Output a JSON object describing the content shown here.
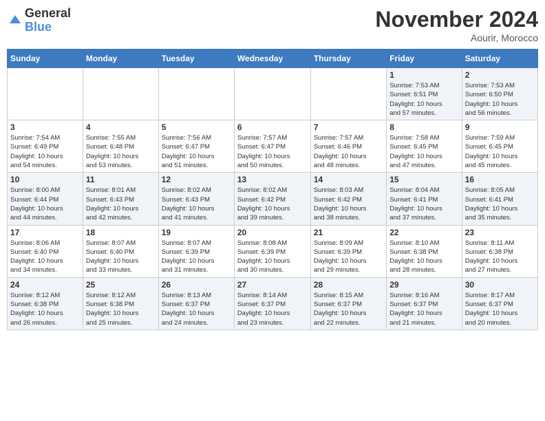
{
  "header": {
    "logo_general": "General",
    "logo_blue": "Blue",
    "month": "November 2024",
    "location": "Aourir, Morocco"
  },
  "weekdays": [
    "Sunday",
    "Monday",
    "Tuesday",
    "Wednesday",
    "Thursday",
    "Friday",
    "Saturday"
  ],
  "weeks": [
    [
      {
        "day": "",
        "detail": ""
      },
      {
        "day": "",
        "detail": ""
      },
      {
        "day": "",
        "detail": ""
      },
      {
        "day": "",
        "detail": ""
      },
      {
        "day": "",
        "detail": ""
      },
      {
        "day": "1",
        "detail": "Sunrise: 7:53 AM\nSunset: 6:51 PM\nDaylight: 10 hours\nand 57 minutes."
      },
      {
        "day": "2",
        "detail": "Sunrise: 7:53 AM\nSunset: 6:50 PM\nDaylight: 10 hours\nand 56 minutes."
      }
    ],
    [
      {
        "day": "3",
        "detail": "Sunrise: 7:54 AM\nSunset: 6:49 PM\nDaylight: 10 hours\nand 54 minutes."
      },
      {
        "day": "4",
        "detail": "Sunrise: 7:55 AM\nSunset: 6:48 PM\nDaylight: 10 hours\nand 53 minutes."
      },
      {
        "day": "5",
        "detail": "Sunrise: 7:56 AM\nSunset: 6:47 PM\nDaylight: 10 hours\nand 51 minutes."
      },
      {
        "day": "6",
        "detail": "Sunrise: 7:57 AM\nSunset: 6:47 PM\nDaylight: 10 hours\nand 50 minutes."
      },
      {
        "day": "7",
        "detail": "Sunrise: 7:57 AM\nSunset: 6:46 PM\nDaylight: 10 hours\nand 48 minutes."
      },
      {
        "day": "8",
        "detail": "Sunrise: 7:58 AM\nSunset: 6:45 PM\nDaylight: 10 hours\nand 47 minutes."
      },
      {
        "day": "9",
        "detail": "Sunrise: 7:59 AM\nSunset: 6:45 PM\nDaylight: 10 hours\nand 45 minutes."
      }
    ],
    [
      {
        "day": "10",
        "detail": "Sunrise: 8:00 AM\nSunset: 6:44 PM\nDaylight: 10 hours\nand 44 minutes."
      },
      {
        "day": "11",
        "detail": "Sunrise: 8:01 AM\nSunset: 6:43 PM\nDaylight: 10 hours\nand 42 minutes."
      },
      {
        "day": "12",
        "detail": "Sunrise: 8:02 AM\nSunset: 6:43 PM\nDaylight: 10 hours\nand 41 minutes."
      },
      {
        "day": "13",
        "detail": "Sunrise: 8:02 AM\nSunset: 6:42 PM\nDaylight: 10 hours\nand 39 minutes."
      },
      {
        "day": "14",
        "detail": "Sunrise: 8:03 AM\nSunset: 6:42 PM\nDaylight: 10 hours\nand 38 minutes."
      },
      {
        "day": "15",
        "detail": "Sunrise: 8:04 AM\nSunset: 6:41 PM\nDaylight: 10 hours\nand 37 minutes."
      },
      {
        "day": "16",
        "detail": "Sunrise: 8:05 AM\nSunset: 6:41 PM\nDaylight: 10 hours\nand 35 minutes."
      }
    ],
    [
      {
        "day": "17",
        "detail": "Sunrise: 8:06 AM\nSunset: 6:40 PM\nDaylight: 10 hours\nand 34 minutes."
      },
      {
        "day": "18",
        "detail": "Sunrise: 8:07 AM\nSunset: 6:40 PM\nDaylight: 10 hours\nand 33 minutes."
      },
      {
        "day": "19",
        "detail": "Sunrise: 8:07 AM\nSunset: 6:39 PM\nDaylight: 10 hours\nand 31 minutes."
      },
      {
        "day": "20",
        "detail": "Sunrise: 8:08 AM\nSunset: 6:39 PM\nDaylight: 10 hours\nand 30 minutes."
      },
      {
        "day": "21",
        "detail": "Sunrise: 8:09 AM\nSunset: 6:39 PM\nDaylight: 10 hours\nand 29 minutes."
      },
      {
        "day": "22",
        "detail": "Sunrise: 8:10 AM\nSunset: 6:38 PM\nDaylight: 10 hours\nand 28 minutes."
      },
      {
        "day": "23",
        "detail": "Sunrise: 8:11 AM\nSunset: 6:38 PM\nDaylight: 10 hours\nand 27 minutes."
      }
    ],
    [
      {
        "day": "24",
        "detail": "Sunrise: 8:12 AM\nSunset: 6:38 PM\nDaylight: 10 hours\nand 26 minutes."
      },
      {
        "day": "25",
        "detail": "Sunrise: 8:12 AM\nSunset: 6:38 PM\nDaylight: 10 hours\nand 25 minutes."
      },
      {
        "day": "26",
        "detail": "Sunrise: 8:13 AM\nSunset: 6:37 PM\nDaylight: 10 hours\nand 24 minutes."
      },
      {
        "day": "27",
        "detail": "Sunrise: 8:14 AM\nSunset: 6:37 PM\nDaylight: 10 hours\nand 23 minutes."
      },
      {
        "day": "28",
        "detail": "Sunrise: 8:15 AM\nSunset: 6:37 PM\nDaylight: 10 hours\nand 22 minutes."
      },
      {
        "day": "29",
        "detail": "Sunrise: 8:16 AM\nSunset: 6:37 PM\nDaylight: 10 hours\nand 21 minutes."
      },
      {
        "day": "30",
        "detail": "Sunrise: 8:17 AM\nSunset: 6:37 PM\nDaylight: 10 hours\nand 20 minutes."
      }
    ]
  ]
}
